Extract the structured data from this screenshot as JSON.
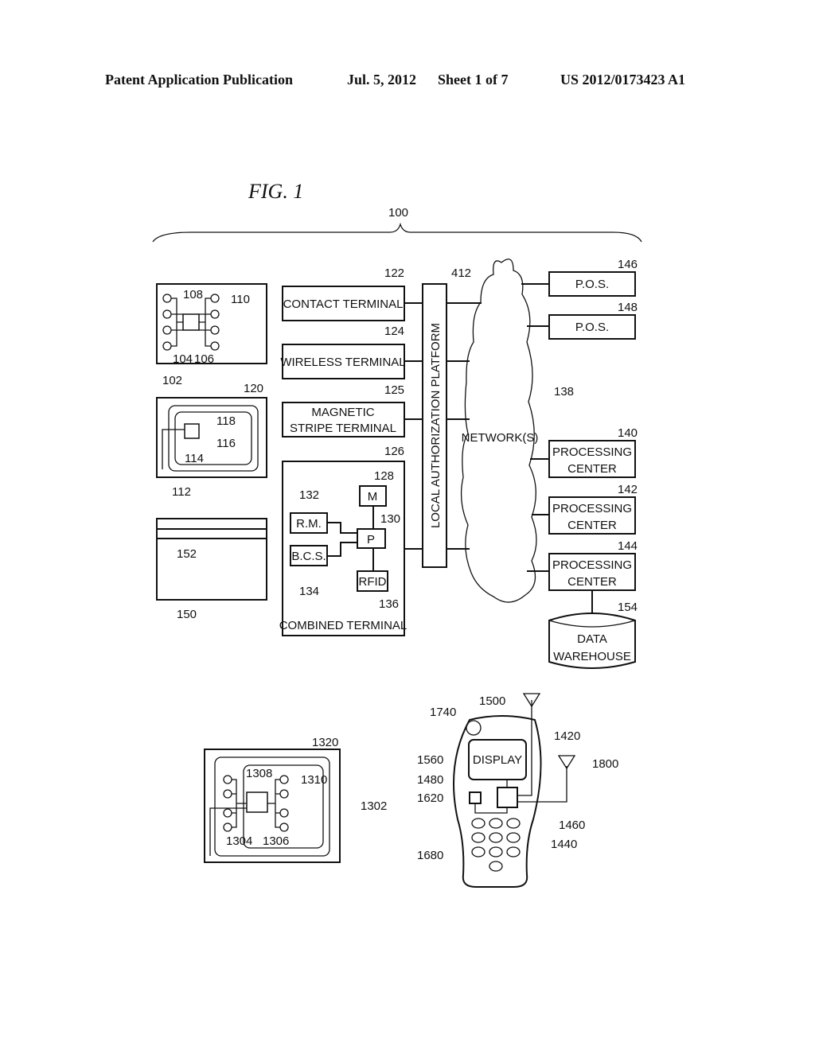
{
  "header": {
    "publication_type": "Patent Application Publication",
    "date": "Jul. 5, 2012",
    "sheet": "Sheet 1 of 7",
    "publication_number": "US 2012/0173423 A1"
  },
  "figure": {
    "title": "FIG.  1",
    "system_ref": "100",
    "cards": {
      "contact_card": {
        "ref": "102",
        "chip_ref": "108",
        "contacts_ref": "110",
        "sub_refs": [
          "104",
          "106"
        ]
      },
      "contactless_card": {
        "ref": "112",
        "antenna_ref": "120",
        "chip_ref": "118",
        "sub_refs": [
          "114",
          "116"
        ]
      },
      "magnetic_card": {
        "ref": "150",
        "stripe_ref": "152"
      }
    },
    "terminals": [
      {
        "ref": "122",
        "label": "CONTACT TERMINAL"
      },
      {
        "ref": "124",
        "label": "WIRELESS TERMINAL"
      },
      {
        "ref": "125",
        "label_line1": "MAGNETIC",
        "label_line2": "STRIPE TERMINAL"
      }
    ],
    "combined_terminal": {
      "ref": "126",
      "label": "COMBINED TERMINAL",
      "components": [
        {
          "ref": "128",
          "label": "M"
        },
        {
          "ref": "130",
          "label": "P"
        },
        {
          "ref": "132",
          "label": "R.M."
        },
        {
          "ref": "134",
          "label": "B.C.S."
        },
        {
          "ref": "136",
          "label": "RFID"
        }
      ]
    },
    "platform": {
      "ref": "412",
      "label": "LOCAL AUTHORIZATION PLATFORM"
    },
    "network": {
      "ref": "138",
      "label": "NETWORK(S)"
    },
    "pos": [
      {
        "ref": "146",
        "label": "P.O.S."
      },
      {
        "ref": "148",
        "label": "P.O.S."
      }
    ],
    "processing_centers": [
      {
        "ref": "140",
        "label_line1": "PROCESSING",
        "label_line2": "CENTER"
      },
      {
        "ref": "142",
        "label_line1": "PROCESSING",
        "label_line2": "CENTER"
      },
      {
        "ref": "144",
        "label_line1": "PROCESSING",
        "label_line2": "CENTER"
      }
    ],
    "data_warehouse": {
      "ref": "154",
      "label_line1": "DATA",
      "label_line2": "WAREHOUSE"
    },
    "dual_card": {
      "ref": "1302",
      "antenna_ref": "1320",
      "chip_ref": "1308",
      "contacts_ref": "1310",
      "sub_refs": [
        "1304",
        "1306"
      ]
    },
    "phone": {
      "display_label": "DISPLAY",
      "refs": {
        "antenna_top": "1500",
        "speaker": "1740",
        "body": "1420",
        "display": "1560",
        "antenna_side": "1800",
        "chip_a": "1480",
        "chip_b": "1620",
        "module_a": "1460",
        "module_b": "1440",
        "keypad": "1680"
      }
    }
  }
}
